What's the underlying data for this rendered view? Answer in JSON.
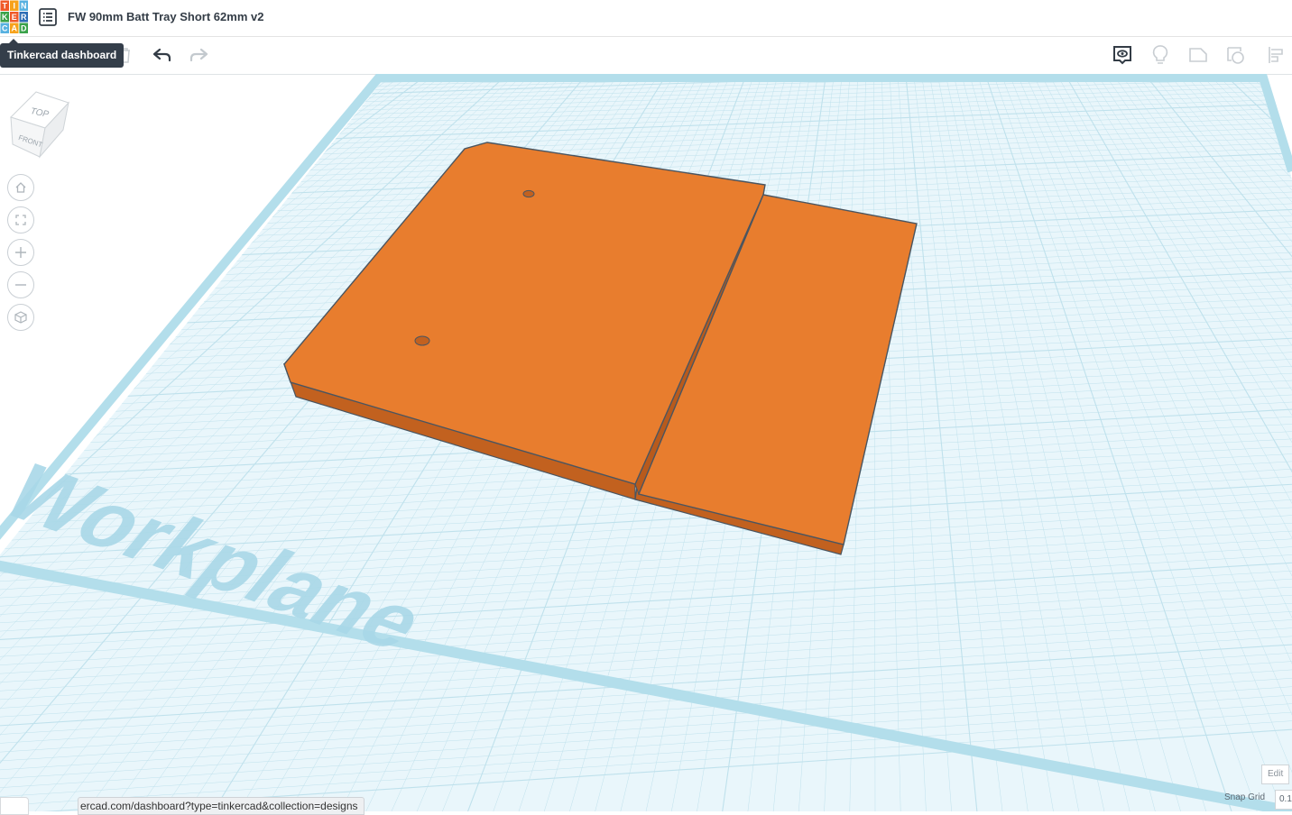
{
  "header": {
    "logo_letters": [
      "T",
      "I",
      "N",
      "K",
      "E",
      "R",
      "C",
      "A",
      "D"
    ],
    "title": "FW 90mm Batt Tray Short 62mm v2"
  },
  "tooltip": {
    "text": "Tinkercad dashboard"
  },
  "toolbar": {
    "left_icons": [
      "copy-icon",
      "delete-icon",
      "undo-icon",
      "redo-icon"
    ],
    "right_icons": [
      "note-icon",
      "light-bulb-icon",
      "solid-shape-icon",
      "hole-shape-icon",
      "align-icon"
    ]
  },
  "viewcube": {
    "top_label": "TOP",
    "front_label": "FRONT"
  },
  "nav_controls": [
    "home-icon",
    "fit-view-icon",
    "zoom-in-icon",
    "zoom-out-icon",
    "perspective-icon"
  ],
  "workplane": {
    "label": "Workplane"
  },
  "model": {
    "color": "#e87d2e",
    "edge_color": "#4a5560",
    "side_color": "#b85a1c"
  },
  "status": {
    "url": "ercad.com/dashboard?type=tinkercad&collection=designs"
  },
  "grid_controls": {
    "edit_label": "Edit",
    "snap_label": "Snap Grid",
    "snap_value": "0.1"
  },
  "colors": {
    "grid_line": "#bfe1ec",
    "grid_bg": "#e6f4fa",
    "logo": [
      "#f05a28",
      "#f7a21b",
      "#57b1e0",
      "#3aa24a",
      "#f05a28",
      "#2d6db5",
      "#57b1e0",
      "#f7a21b",
      "#3aa24a"
    ]
  }
}
